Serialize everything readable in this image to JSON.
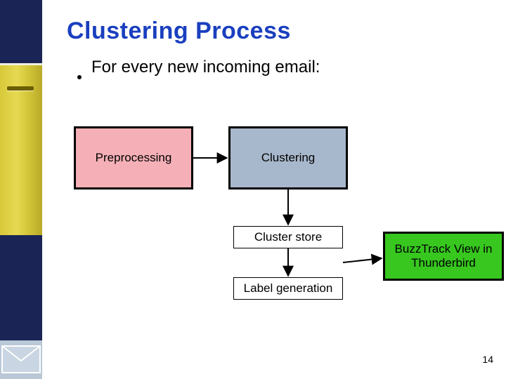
{
  "title": "Clustering Process",
  "bullet": "For every new incoming email:",
  "boxes": {
    "preprocessing": "Preprocessing",
    "clustering": "Clustering",
    "cluster_store": "Cluster store",
    "label_generation": "Label generation",
    "buzztrack": "BuzzTrack View in Thunderbird"
  },
  "page_number": "14",
  "colors": {
    "title": "#1a3fbf",
    "preprocessing_fill": "#f4b0b6",
    "clustering_fill": "#a8b8cc",
    "buzztrack_fill": "#37c71f"
  }
}
